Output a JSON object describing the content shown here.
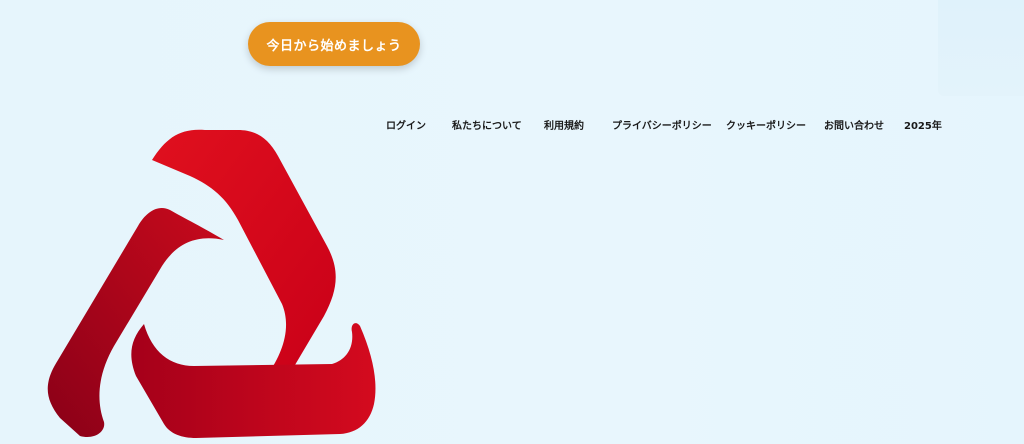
{
  "cta": {
    "label": "今日から始めましょう"
  },
  "nav": {
    "items": [
      {
        "label": "ログイン"
      },
      {
        "label": "私たちについて"
      },
      {
        "label": "利用規約"
      },
      {
        "label": "プライバシーポリシー"
      },
      {
        "label": "クッキーポリシー"
      },
      {
        "label": "お問い合わせ"
      },
      {
        "label": "2025年"
      }
    ]
  },
  "colors": {
    "background": "#e7f5fc",
    "cta": "#e8931f",
    "logo_red_light": "#e0101e",
    "logo_red_dark": "#8a0018",
    "nav_text": "#1a1a1a"
  },
  "icons": {
    "logo": "red-triangle-arrows-logo"
  }
}
